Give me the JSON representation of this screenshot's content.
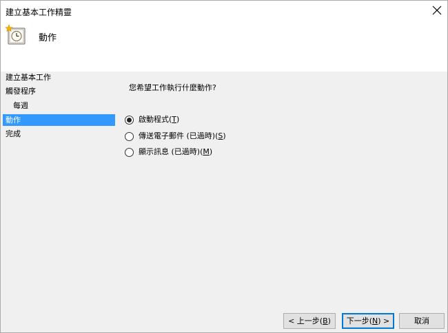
{
  "window": {
    "title": "建立基本工作精靈"
  },
  "header": {
    "title": "動作",
    "icon": "task-scheduler-clock-icon"
  },
  "steps": [
    {
      "label": "建立基本工作",
      "sub": false,
      "active": false
    },
    {
      "label": "觸發程序",
      "sub": false,
      "active": false
    },
    {
      "label": "每週",
      "sub": true,
      "active": false
    },
    {
      "label": "動作",
      "sub": false,
      "active": true
    },
    {
      "label": "完成",
      "sub": false,
      "active": false
    }
  ],
  "main": {
    "question": "您希望工作執行什麼動作?",
    "options": [
      {
        "label": "啟動程式",
        "mnemonic": "T",
        "checked": true
      },
      {
        "label": "傳送電子郵件 (已過時)",
        "mnemonic": "S",
        "checked": false
      },
      {
        "label": "顯示訊息 (已過時)",
        "mnemonic": "M",
        "checked": false
      }
    ]
  },
  "buttons": {
    "back": {
      "prefix": "< 上一步(",
      "mnemonic": "B",
      "suffix": ")"
    },
    "next": {
      "prefix": "下一步(",
      "mnemonic": "N",
      "suffix": ") >"
    },
    "cancel": {
      "label": "取消"
    }
  },
  "colors": {
    "selection": "#3399ff",
    "body_bg": "#f0f0f0",
    "default_button_border": "#0078d7"
  }
}
